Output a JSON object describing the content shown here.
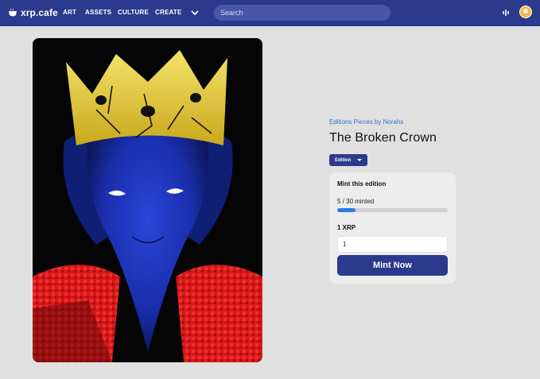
{
  "header": {
    "logo_text": "xrp.cafe",
    "nav": [
      "ART",
      "ASSETS",
      "CULTURE",
      "CREATE"
    ],
    "search_placeholder": "Search"
  },
  "icons": {
    "logo": "coffee-cup-icon",
    "more": "chevron-down-icon",
    "wallet": "wallet-icon",
    "avatar": "user-avatar"
  },
  "nft": {
    "collection": "Editions Pieces by Norahs",
    "title": "The Broken Crown",
    "edition_label": "Edition"
  },
  "mint": {
    "heading": "Mint this edition",
    "minted_text": "5 / 30 minted",
    "progress_fraction": 0.1667,
    "price": "1 XRP",
    "quantity": "1",
    "button": "Mint Now"
  },
  "colors": {
    "header_bg": "#2b3a8c",
    "accent": "#2b3a8c",
    "link": "#3a6fc9",
    "progress": "#2d7be3",
    "page_bg": "#e0e0e0"
  }
}
